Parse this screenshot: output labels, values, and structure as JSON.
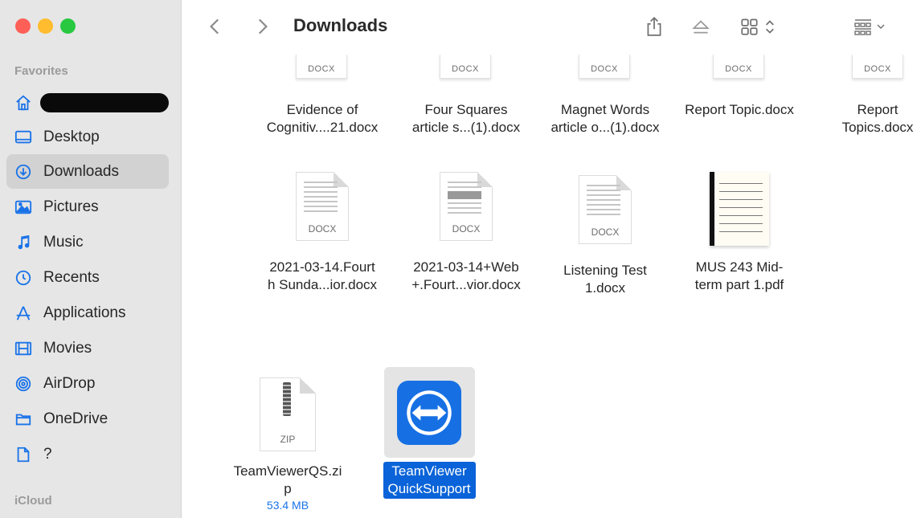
{
  "window": {
    "title": "Downloads"
  },
  "sidebar": {
    "favorites_label": "Favorites",
    "icloud_label": "iCloud",
    "items": [
      {
        "label": "",
        "icon": "home-icon",
        "redacted": true
      },
      {
        "label": "Desktop",
        "icon": "desktop-icon"
      },
      {
        "label": "Downloads",
        "icon": "downloads-icon",
        "active": true
      },
      {
        "label": "Pictures",
        "icon": "pictures-icon"
      },
      {
        "label": "Music",
        "icon": "music-icon"
      },
      {
        "label": "Recents",
        "icon": "clock-icon"
      },
      {
        "label": "Applications",
        "icon": "applications-icon"
      },
      {
        "label": "Movies",
        "icon": "movies-icon"
      },
      {
        "label": "AirDrop",
        "icon": "airdrop-icon"
      },
      {
        "label": "OneDrive",
        "icon": "folder-icon"
      },
      {
        "label": "?",
        "icon": "document-icon"
      }
    ]
  },
  "toolbar": {
    "back": "back-chevron-icon",
    "forward": "forward-chevron-icon",
    "share": "share-icon",
    "eject": "eject-icon",
    "view": "grid-view-icon",
    "group": "group-by-icon"
  },
  "files": {
    "row1": [
      {
        "name": "Evidence of Cognitiv....21.docx",
        "line1": "Evidence of",
        "line2": "Cognitiv....21.docx",
        "type": "DOCX"
      },
      {
        "name": "Four Squares article s...(1).docx",
        "line1": "Four Squares",
        "line2": "article s...(1).docx",
        "type": "DOCX"
      },
      {
        "name": "Magnet Words article o...(1).docx",
        "line1": "Magnet Words",
        "line2": "article o...(1).docx",
        "type": "DOCX"
      },
      {
        "name": "Report Topic.docx",
        "line1": "Report Topic.docx",
        "line2": "",
        "type": "DOCX"
      },
      {
        "name": "Report Topics.docx",
        "line1": "Report",
        "line2": "Topics.docx",
        "type": "DOCX"
      }
    ],
    "row2": [
      {
        "line1": "2021-03-14.Fourt",
        "line2": "h Sunda...ior.docx",
        "type": "DOCX"
      },
      {
        "line1": "2021-03-14+Web",
        "line2": "+.Fourt...vior.docx",
        "type": "DOCX"
      },
      {
        "line1": "Listening Test",
        "line2": "1.docx",
        "type": "DOCX"
      },
      {
        "line1": "MUS 243  Mid-",
        "line2": "term part 1.pdf",
        "type": "PDF"
      }
    ],
    "row3": [
      {
        "line1": "TeamViewerQS.zi",
        "line2": "p",
        "size": "53.4 MB",
        "type": "ZIP"
      },
      {
        "line1": "TeamViewer",
        "line2": "QuickSupport",
        "selected": true
      }
    ]
  },
  "colors": {
    "accent": "#0a63d8",
    "sidebar_bg": "#e6e6e6",
    "selection_bg": "#d2d2d2"
  }
}
